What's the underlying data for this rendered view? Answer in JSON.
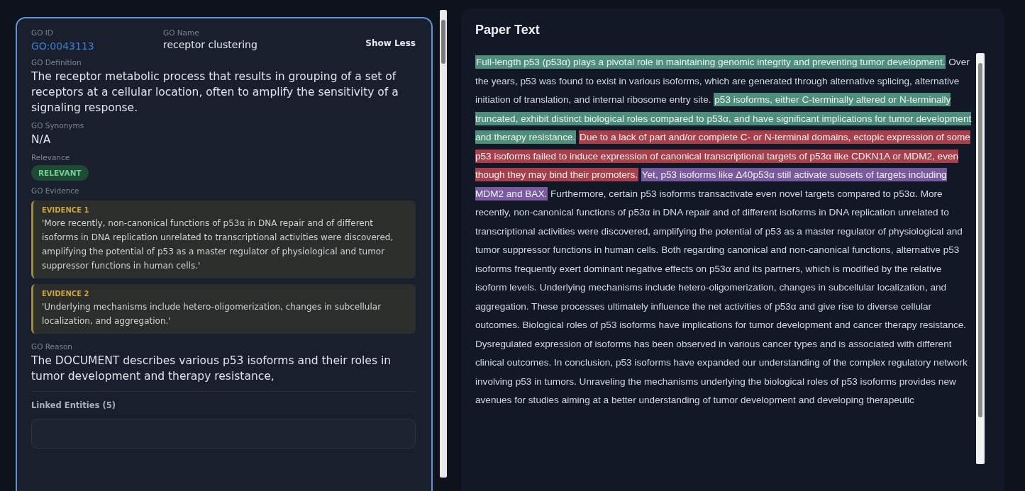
{
  "go_card": {
    "fields": [
      {
        "label": "GO ID",
        "value": "GO:0043113",
        "kind": "link"
      },
      {
        "label": "GO Name",
        "value": "receptor clustering",
        "kind": "text"
      }
    ],
    "toggle_button": "Show Less",
    "definition": {
      "label": "GO Definition",
      "value": "The receptor metabolic process that results in grouping of a set of receptors at a cellular location, often to amplify the sensitivity of a signaling response."
    },
    "synonyms": {
      "label": "GO Synonyms",
      "value": "N/A"
    },
    "relevance": {
      "label": "Relevance",
      "value": "RELEVANT"
    },
    "evidence": {
      "label": "GO Evidence",
      "items": [
        {
          "title": "EVIDENCE 1",
          "text": "'More recently, non-canonical functions of p53α in DNA repair and of different isoforms in DNA replication unrelated to transcriptional activities were discovered, amplifying the potential of p53 as a master regulator of physiological and tumor suppressor functions in human cells.'"
        },
        {
          "title": "EVIDENCE 2",
          "text": "'Underlying mechanisms include hetero-oligomerization, changes in subcellular localization, and aggregation.'"
        }
      ]
    },
    "reason": {
      "label": "GO Reason",
      "value": "The DOCUMENT describes various p53 isoforms and their roles in tumor development and therapy resistance,"
    },
    "linked_entities": "Linked Entities (5)"
  },
  "paper": {
    "title": "Paper Text",
    "segments": [
      {
        "text": "Full-length p53 (p53α) plays a pivotal role in maintaining genomic integrity and preventing tumor development.",
        "color": "#4e8f7c"
      },
      {
        "text": "Over the years, p53 was found to exist in various isoforms, which are generated through alternative splicing, alternative initiation of translation, and internal ribosome entry site."
      },
      {
        "text": "p53 isoforms, either C-terminally altered or N-terminally truncated, exhibit distinct biological roles compared to p53α, and have significant implications for tumor development and therapy resistance.",
        "color": "#4e8f7c"
      },
      {
        "text": "Due to a lack of part and/or complete C- or N-terminal domains, ectopic expression of some p53 isoforms failed to induce expression of canonical transcriptional targets of p53α like CDKN1A or MDM2, even though they may bind their promoters.",
        "color": "#a8404c"
      },
      {
        "text": "Yet, p53 isoforms like Δ40p53α still activate subsets of targets including MDM2 and BAX.",
        "color": "#7a5a9e"
      },
      {
        "text": "Furthermore, certain p53 isoforms transactivate even novel targets compared to p53α. More recently, non-canonical functions of p53α in DNA repair and of different isoforms in DNA replication unrelated to transcriptional activities were discovered, amplifying the potential of p53 as a master regulator of physiological and tumor suppressor functions in human cells. Both regarding canonical and non-canonical functions, alternative p53 isoforms frequently exert dominant negative effects on p53α and its partners, which is modified by the relative isoform levels. Underlying mechanisms include hetero-oligomerization, changes in subcellular localization, and aggregation. These processes ultimately influence the net activities of p53α and give rise to diverse cellular outcomes. Biological roles of p53 isoforms have implications for tumor development and cancer therapy resistance. Dysregulated expression of isoforms has been observed in various cancer types and is associated with different clinical outcomes. In conclusion, p53 isoforms have expanded our understanding of the complex regulatory network involving p53 in tumors. Unraveling the mechanisms underlying the biological roles of p53 isoforms provides new avenues for studies aiming at a better understanding of tumor development and developing therapeutic"
      }
    ]
  }
}
